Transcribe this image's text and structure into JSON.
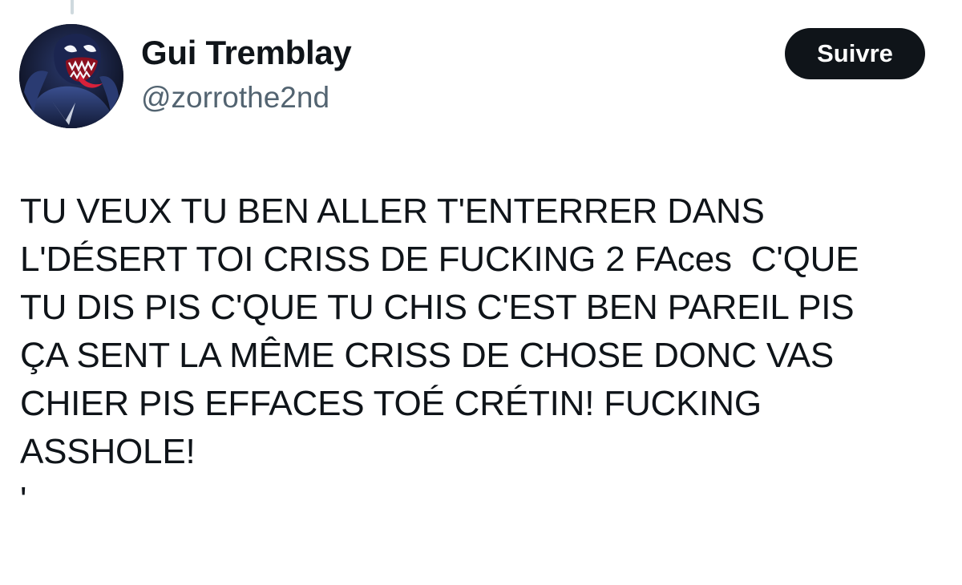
{
  "author": {
    "display_name": "Gui Tremblay",
    "handle": "@zorrothe2nd",
    "avatar_icon": "venom-avatar-icon"
  },
  "actions": {
    "follow_label": "Suivre"
  },
  "tweet": {
    "text": "TU VEUX TU BEN ALLER T'ENTERRER DANS\nL'DÉSERT TOI CRISS DE FUCKING 2 FAces  C'QUE\nTU DIS PIS C'QUE TU CHIS C'EST BEN PAREIL PIS\nÇA SENT LA MÊME CRISS DE CHOSE DONC VAS\nCHIER PIS EFFACES TOÉ CRÉTIN! FUCKING\nASSHOLE!\n'"
  },
  "colors": {
    "text_primary": "#0f1419",
    "text_secondary": "#536471",
    "button_bg": "#0f1419",
    "button_text": "#ffffff",
    "thread_line": "#cfd9de"
  }
}
